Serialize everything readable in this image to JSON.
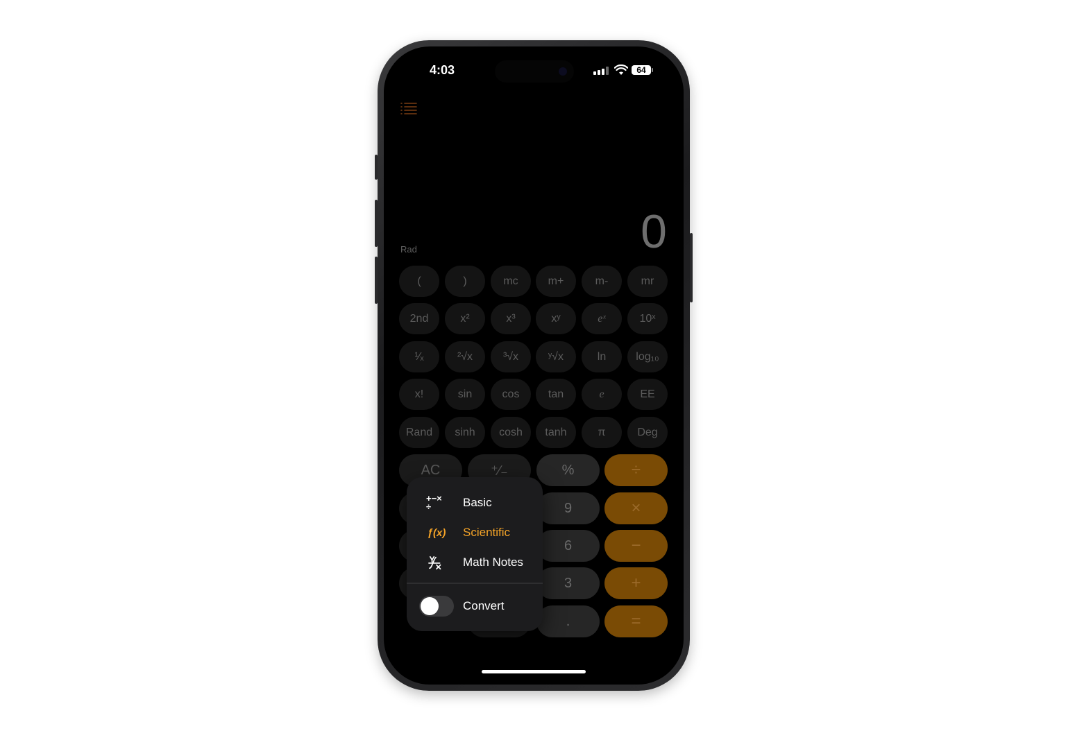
{
  "status_bar": {
    "time": "4:03",
    "battery": "64",
    "icons": [
      "signal-icon",
      "wifi-icon",
      "battery-icon"
    ]
  },
  "calculator": {
    "angle_mode": "Rad",
    "display": "0"
  },
  "scientific_keys": {
    "row1": [
      "(",
      ")",
      "mc",
      "m+",
      "m-",
      "mr"
    ],
    "row2": [
      "2nd",
      "x²",
      "x³",
      "xʸ",
      "eˣ",
      "10ˣ"
    ],
    "row3": [
      "¹⁄ₓ",
      "²√x",
      "³√x",
      "ʸ√x",
      "ln",
      "log₁₀"
    ],
    "row4": [
      "x!",
      "sin",
      "cos",
      "tan",
      "e",
      "EE"
    ],
    "row5": [
      "Rand",
      "sinh",
      "cosh",
      "tanh",
      "π",
      "Deg"
    ]
  },
  "basic_keys": {
    "ac": "AC",
    "plus_minus": "⁺∕₋",
    "percent": "%",
    "divide": "÷",
    "nine": "9",
    "multiply": "×",
    "six": "6",
    "minus": "−",
    "three": "3",
    "plus": "+",
    "decimal": ".",
    "equals": "="
  },
  "mode_menu": {
    "items": [
      {
        "label": "Basic",
        "icon": "+−×÷",
        "selected": false
      },
      {
        "label": "Scientific",
        "icon": "ƒ(x)",
        "selected": true
      },
      {
        "label": "Math Notes",
        "icon": "math-notes-icon",
        "selected": false
      }
    ],
    "convert_label": "Convert",
    "convert_on": false
  },
  "colors": {
    "accent": "#f5a428",
    "operator_key": "#7a4b05"
  }
}
